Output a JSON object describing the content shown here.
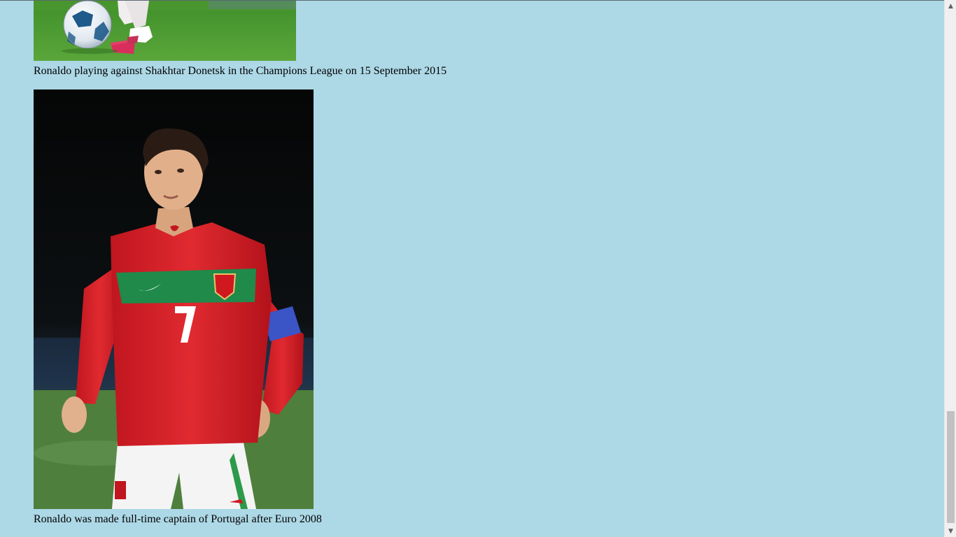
{
  "page": {
    "background_color": "#add8e6"
  },
  "figures": [
    {
      "image_alt": "Ronaldo playing against Shakhtar Donetsk",
      "caption": "Ronaldo playing against Shakhtar Donetsk in the Champions League on 15 September 2015"
    },
    {
      "image_alt": "Ronaldo in Portugal kit",
      "caption": "Ronaldo was made full-time captain of Portugal after Euro 2008"
    }
  ],
  "scrollbar": {
    "up_icon": "arrow-up-icon",
    "down_icon": "arrow-down-icon",
    "scroll_position": 0.93
  }
}
